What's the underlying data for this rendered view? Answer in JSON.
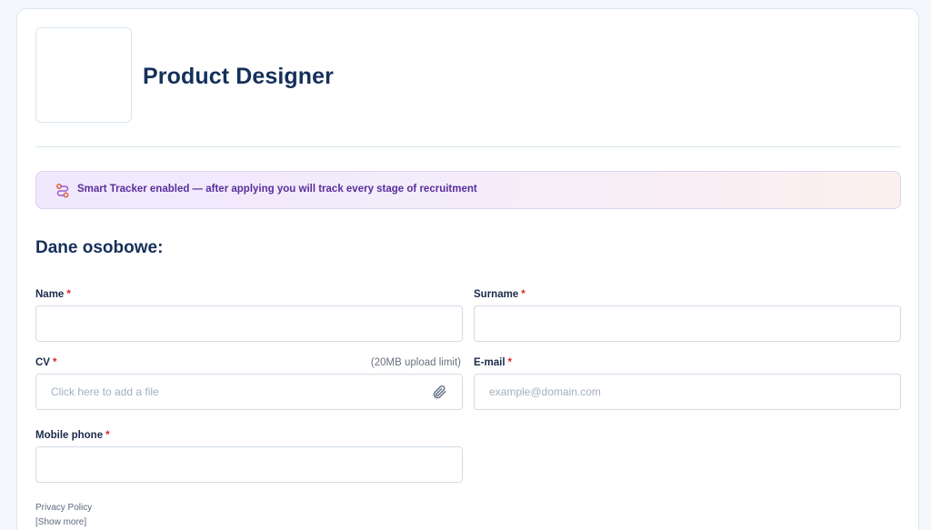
{
  "job": {
    "title": "Product Designer"
  },
  "banner": {
    "text": "Smart Tracker enabled — after applying you will track every stage of recruitment",
    "icon": "tracker-icon",
    "accent": "#5a2e9c"
  },
  "section": {
    "title": "Dane osobowe:"
  },
  "form": {
    "required_mark": "*",
    "name": {
      "label": "Name",
      "value": ""
    },
    "surname": {
      "label": "Surname",
      "value": ""
    },
    "cv": {
      "label": "CV",
      "hint": "(20MB upload limit)",
      "placeholder": "Click here to add a file",
      "icon": "paperclip-icon"
    },
    "email": {
      "label": "E-mail",
      "placeholder": "example@domain.com",
      "value": ""
    },
    "phone": {
      "label": "Mobile phone",
      "value": ""
    }
  },
  "footer": {
    "privacy": "Privacy Policy",
    "show_more": "[Show more]"
  }
}
